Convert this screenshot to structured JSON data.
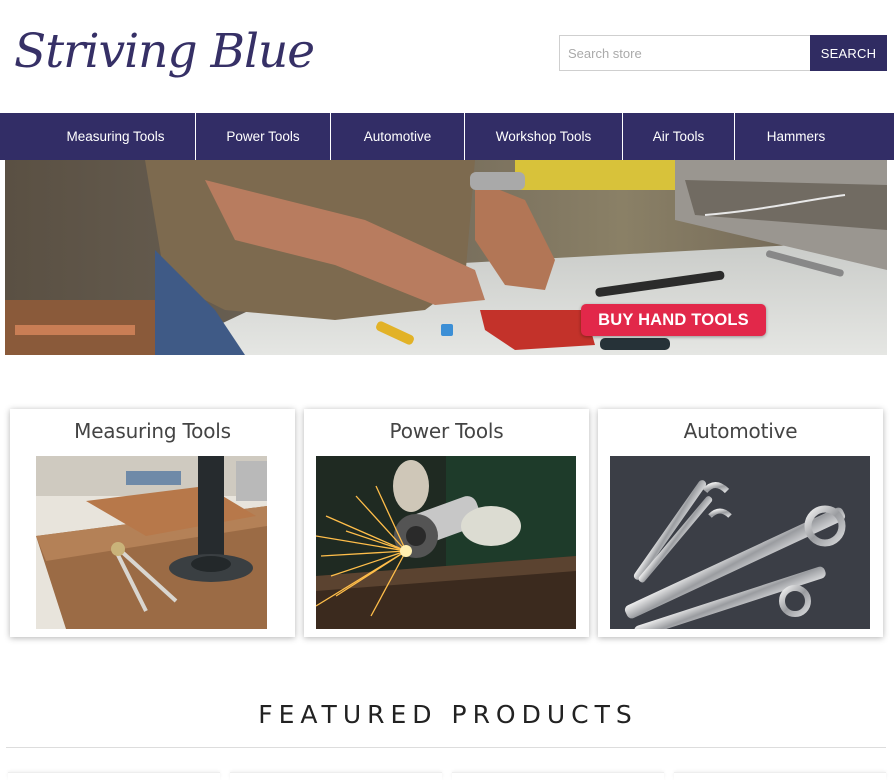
{
  "header": {
    "logo_text": "Striving Blue",
    "search_placeholder": "Search store",
    "search_button": "SEARCH"
  },
  "nav": {
    "items": [
      {
        "label": "Measuring Tools"
      },
      {
        "label": "Power Tools"
      },
      {
        "label": "Automotive"
      },
      {
        "label": "Workshop Tools"
      },
      {
        "label": "Air Tools"
      },
      {
        "label": "Hammers"
      }
    ]
  },
  "hero": {
    "cta_label": "BUY HAND TOOLS"
  },
  "categories": [
    {
      "title": "Measuring Tools"
    },
    {
      "title": "Power Tools"
    },
    {
      "title": "Automotive"
    }
  ],
  "featured": {
    "heading": "FEATURED PRODUCTS"
  },
  "colors": {
    "brand": "#322d66",
    "cta": "#e2284a",
    "slider_dot": "#3c8fd6"
  }
}
